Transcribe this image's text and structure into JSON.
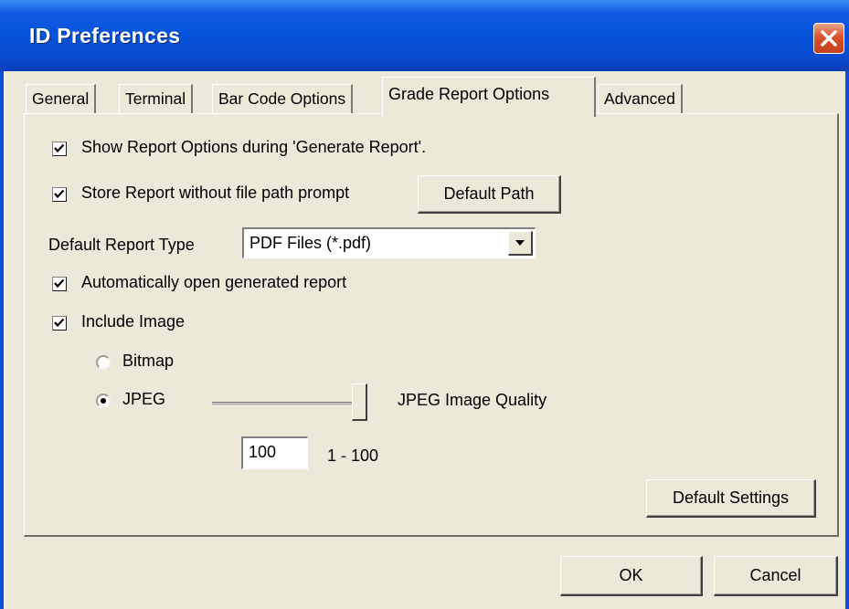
{
  "window": {
    "title": "ID Preferences"
  },
  "tabs": [
    {
      "label": "General",
      "active": false
    },
    {
      "label": "Terminal",
      "active": false
    },
    {
      "label": "Bar Code Options",
      "active": false
    },
    {
      "label": "Grade Report Options",
      "active": true
    },
    {
      "label": "Advanced",
      "active": false
    }
  ],
  "options": {
    "show_report_options": {
      "label": "Show Report Options during 'Generate Report'.",
      "checked": true
    },
    "store_report": {
      "label": "Store Report without file path prompt",
      "checked": true
    },
    "default_path_button": "Default Path",
    "report_type_label": "Default Report Type",
    "report_type_value": "PDF Files (*.pdf)",
    "auto_open": {
      "label": "Automatically open generated report",
      "checked": true
    },
    "include_image": {
      "label": "Include Image",
      "checked": true
    },
    "bitmap": {
      "label": "Bitmap",
      "selected": false
    },
    "jpeg": {
      "label": "JPEG",
      "selected": true
    },
    "jpeg_quality_label": "JPEG Image Quality",
    "jpeg_quality_value": "100",
    "jpeg_quality_range": "1 - 100",
    "jpeg_quality_level": 100,
    "default_settings_button": "Default Settings"
  },
  "footer": {
    "ok": "OK",
    "cancel": "Cancel"
  }
}
